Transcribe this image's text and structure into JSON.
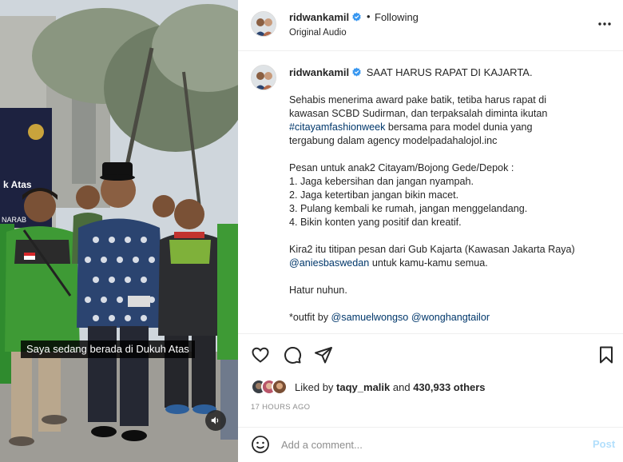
{
  "media": {
    "subtitle": "Saya sedang berada di Dukuh Atas",
    "sign_texts": [
      "k Atas",
      "NARAB"
    ],
    "mute_icon": "speaker-icon"
  },
  "header": {
    "username": "ridwankamil",
    "separator": "•",
    "follow_status": "Following",
    "audio": "Original Audio",
    "more_icon": "more-horizontal-icon"
  },
  "caption": {
    "username": "ridwankamil",
    "title": "SAAT HARUS RAPAT DI KAJARTA.",
    "p1_a": "Sehabis menerima award pake batik, tetiba harus rapat di kawasan SCBD Sudirman, dan terpaksalah diminta ikutan",
    "hashtag": "#citayamfashionweek",
    "p1_b": "bersama para model dunia yang tergabung dalam agency modelpadahalojol.inc",
    "p2_intro": "Pesan untuk anak2 Citayam/Bojong Gede/Depok :",
    "list": [
      "1. Jaga kebersihan dan jangan nyampah.",
      "2. Jaga ketertiban jangan bikin macet.",
      "3. Pulang kembali ke rumah, jangan menggelandang.",
      "4. Bikin konten yang positif dan kreatif."
    ],
    "p3_a": "Kira2 itu titipan pesan dari Gub Kajarta (Kawasan Jakarta Raya)",
    "mention_anies": "@aniesbaswedan",
    "p3_b": "untuk kamu-kamu semua.",
    "p4": "Hatur nuhun.",
    "outfit_prefix": "*outfit by",
    "mention_1": "@samuelwongso",
    "mention_2": "@wonghangtailor"
  },
  "actions": {
    "icons": [
      "heart-icon",
      "comment-icon",
      "share-icon",
      "bookmark-icon"
    ],
    "liked_prefix": "Liked by",
    "liked_user": "taqy_malik",
    "liked_mid": "and",
    "liked_count": "430,933 others",
    "timestamp": "17 HOURS AGO"
  },
  "comment": {
    "placeholder": "Add a comment...",
    "post_label": "Post"
  },
  "colors": {
    "verified": "#3897f0",
    "link": "#00376b",
    "post_disabled": "#b2dffc",
    "muted_text": "#8e8e8e",
    "jacket_green": "#3e9a35"
  }
}
